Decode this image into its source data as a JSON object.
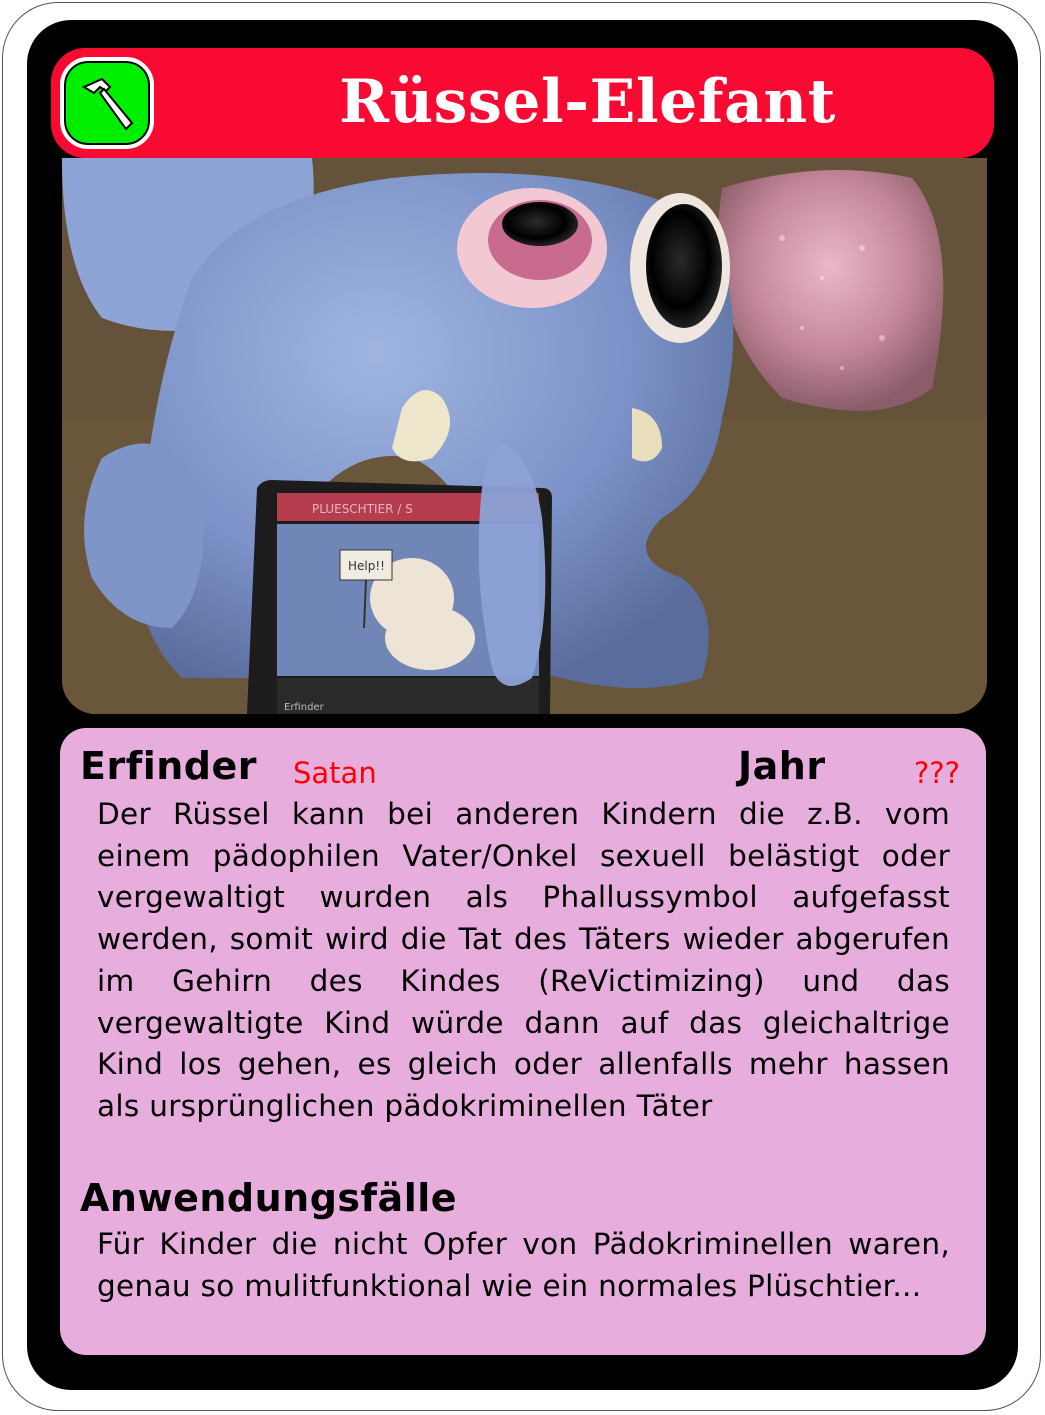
{
  "card": {
    "title": "Rüssel-Elefant",
    "type_icon": "hammer-icon",
    "photo": {
      "subject": "plush-elephant-photo",
      "inner_card": {
        "header": "PLUESCHTIER / S",
        "sign_text": "Help!!",
        "footer_label": "Erfinder"
      }
    },
    "info": {
      "inventor_label": "Erfinder",
      "inventor_value": "Satan",
      "year_label": "Jahr",
      "year_value": "???",
      "description": "Der Rüssel kann bei anderen Kindern die z.B. vom einem pädophilen Vater/Onkel sexuell belästigt oder vergewaltigt wurden als Phallussymbol aufgefasst werden, somit wird die Tat des Täters wieder abgerufen im Gehirn des Kindes (ReVictimizing) und das vergewaltigte Kind würde dann auf das gleichaltrige Kind los gehen, es gleich oder allenfalls mehr hassen als ursprünglichen pädokriminellen Täter",
      "usecases_label": "Anwendungsfälle",
      "usecases_text": "Für Kinder die nicht Opfer von Pädokriminellen waren, genau so mulitfunktional wie ein normales Plüschtier..."
    }
  },
  "colors": {
    "title_bar": "#f90a33",
    "badge": "#00ee00",
    "panel": "#e7aedd",
    "value_text": "#ff0000"
  }
}
